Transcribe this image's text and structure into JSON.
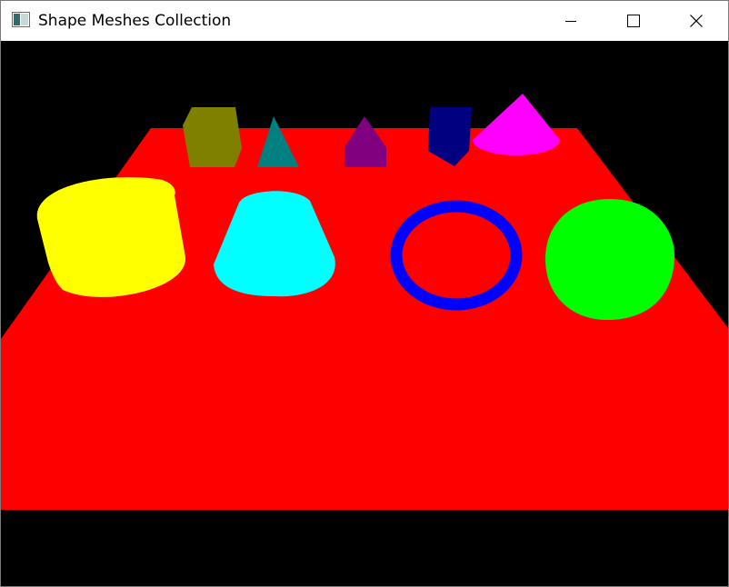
{
  "window": {
    "title": "Shape Meshes Collection",
    "icons": {
      "app": "app-window-icon",
      "minimize": "minimize-icon",
      "maximize": "maximize-icon",
      "close": "close-icon"
    }
  },
  "scene": {
    "background_color": "#000000",
    "plane_color": "#ff0000",
    "objects": [
      {
        "name": "hexagonal-prism",
        "color": "#808000"
      },
      {
        "name": "pyramid",
        "color": "#008080"
      },
      {
        "name": "house-prism",
        "color": "#800080"
      },
      {
        "name": "pentagonal-prism",
        "color": "#000080"
      },
      {
        "name": "cone",
        "color": "#ff00ff"
      },
      {
        "name": "cylinder",
        "color": "#ffff00"
      },
      {
        "name": "truncated-cone",
        "color": "#00ffff"
      },
      {
        "name": "torus",
        "color": "#0000ff"
      },
      {
        "name": "sphere",
        "color": "#00ff00"
      }
    ]
  }
}
